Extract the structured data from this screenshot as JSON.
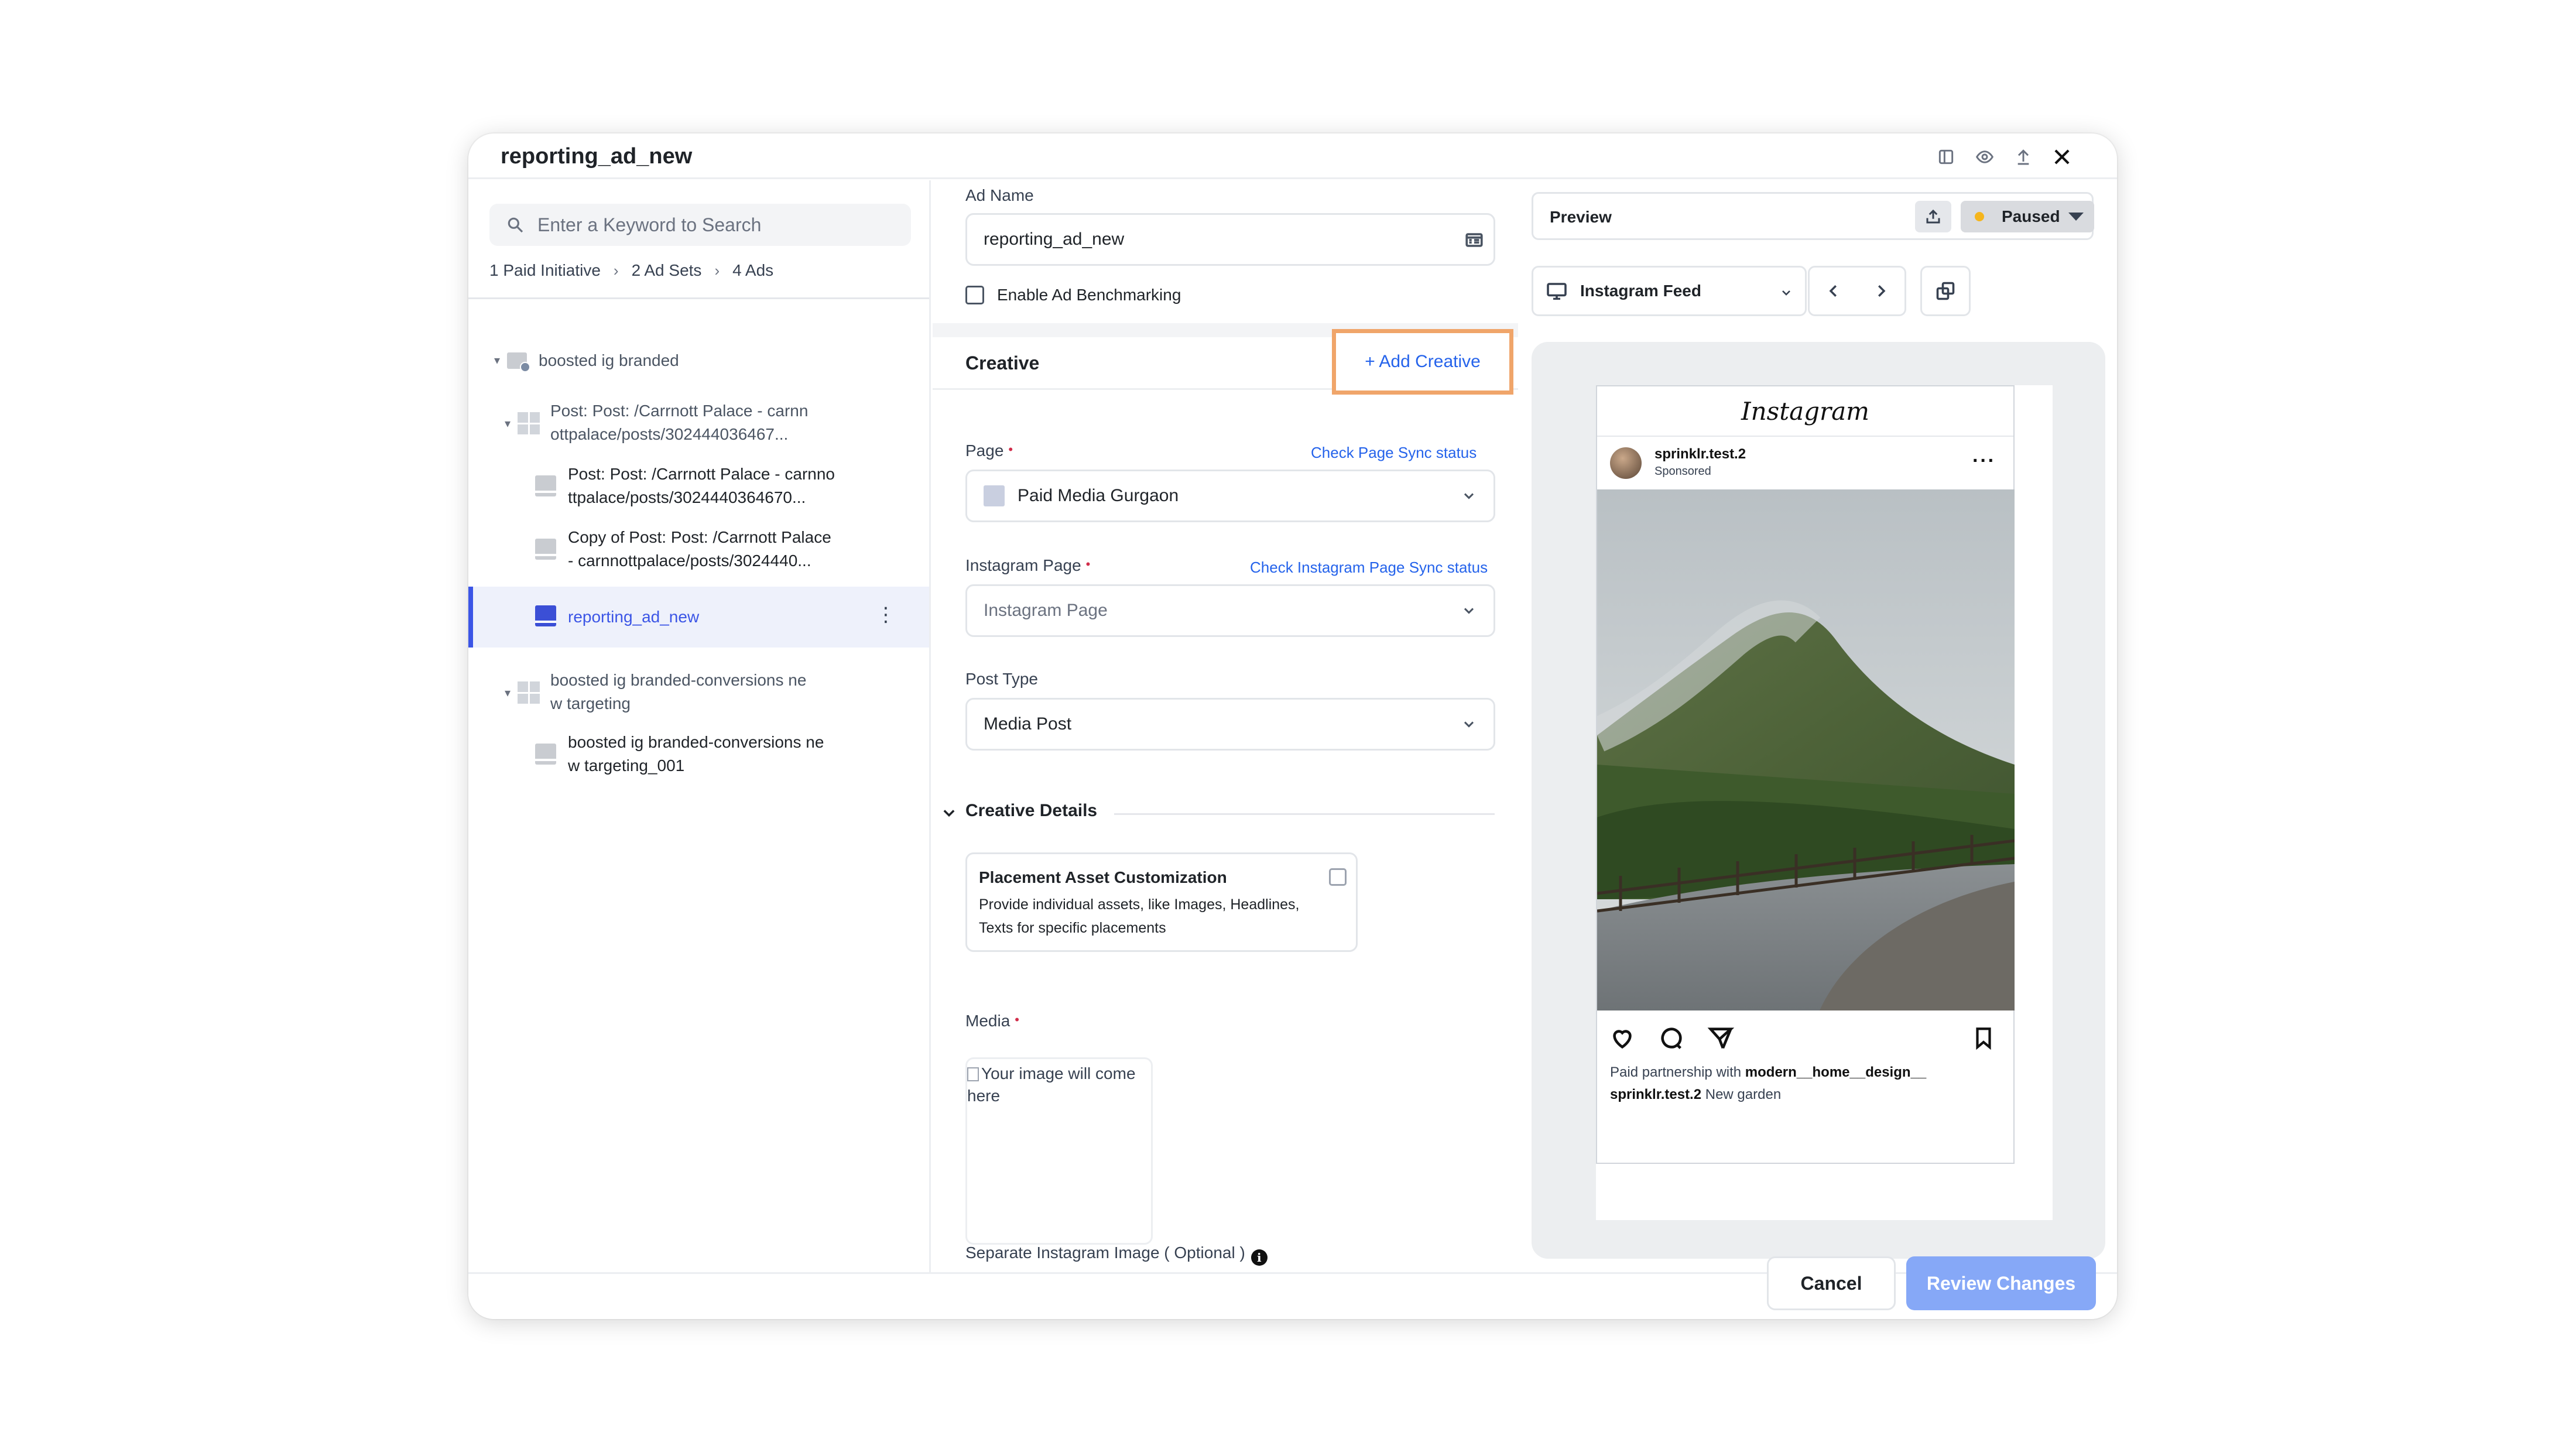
{
  "modal": {
    "title": "reporting_ad_new"
  },
  "search": {
    "placeholder": "Enter a Keyword to Search"
  },
  "breadcrumb": [
    "1 Paid Initiative",
    "2 Ad Sets",
    "4 Ads"
  ],
  "tree": {
    "campaign": "boosted ig branded",
    "adset1": [
      "Post: Post: /Carrnott Palace - carnn",
      "ottpalace/posts/302444036467..."
    ],
    "ad1": [
      "Post: Post: /Carrnott Palace - carnno",
      "ttpalace/posts/3024440364670..."
    ],
    "ad2": [
      "Copy of Post: Post: /Carrnott Palace",
      "- carnnottpalace/posts/3024440..."
    ],
    "ad3": "reporting_ad_new",
    "adset2": [
      "boosted ig branded-conversions ne",
      "w targeting"
    ],
    "ad4": [
      "boosted ig branded-conversions ne",
      "w targeting_001"
    ]
  },
  "form": {
    "ad_name_label": "Ad Name",
    "ad_name_value": "reporting_ad_new",
    "benchmark_label": "Enable Ad Benchmarking",
    "creative_title": "Creative",
    "add_creative": "+ Add Creative",
    "page_label": "Page",
    "page_link": "Check Page Sync status",
    "page_value": "Paid Media Gurgaon",
    "ig_page_label": "Instagram Page",
    "ig_page_link": "Check Instagram Page Sync status",
    "ig_page_placeholder": "Instagram Page",
    "post_type_label": "Post Type",
    "post_type_value": "Media Post",
    "creative_details": "Creative Details",
    "pac_title": "Placement Asset Customization",
    "pac_desc": "Provide individual assets, like Images, Headlines, Texts for specific placements",
    "media_label": "Media",
    "media_placeholder": "Your image will come here",
    "sep_ig_label": "Separate Instagram Image ( Optional )",
    "required_mark": "•"
  },
  "preview": {
    "label": "Preview",
    "status": "Paused",
    "placement": "Instagram Feed",
    "ig_logo": "Instagram",
    "username": "sprinklr.test.2",
    "sponsored": "Sponsored",
    "caption_prefix": "Paid partnership with",
    "caption_partner": "modern__home__design__",
    "caption_user": "sprinklr.test.2",
    "caption_text": "New garden"
  },
  "footer": {
    "cancel": "Cancel",
    "review": "Review Changes"
  },
  "colors": {
    "accent": "#3b55e6",
    "link": "#2563eb",
    "highlight": "#f0a56a",
    "review_btn": "#86a8f7",
    "status_dot": "#f5b51c"
  }
}
